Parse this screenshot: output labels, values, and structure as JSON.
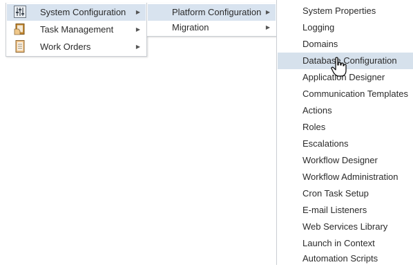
{
  "menu_level1": {
    "items": [
      {
        "label": "System Configuration",
        "icon": "settings-sliders-icon",
        "selected": true
      },
      {
        "label": "Task Management",
        "icon": "clipboard-hand-icon",
        "selected": false
      },
      {
        "label": "Work Orders",
        "icon": "document-icon",
        "selected": false
      }
    ]
  },
  "menu_level2": {
    "items": [
      {
        "label": "Platform Configuration",
        "selected": true
      },
      {
        "label": "Migration",
        "selected": false
      }
    ]
  },
  "menu_level3": {
    "items": [
      {
        "label": "System Properties"
      },
      {
        "label": "Logging"
      },
      {
        "label": "Domains"
      },
      {
        "label": "Database Configuration"
      },
      {
        "label": "Application Designer"
      },
      {
        "label": "Communication Templates"
      },
      {
        "label": "Actions"
      },
      {
        "label": "Roles"
      },
      {
        "label": "Escalations"
      },
      {
        "label": "Workflow Designer"
      },
      {
        "label": "Workflow Administration"
      },
      {
        "label": "Cron Task Setup"
      },
      {
        "label": "E-mail Listeners"
      },
      {
        "label": "Web Services Library"
      },
      {
        "label": "Launch in Context"
      },
      {
        "label": "Automation Scripts"
      }
    ],
    "hovered": "Database Configuration"
  },
  "colors": {
    "selected_bg": "#d8e3ef",
    "border": "#c9cdd2",
    "text": "#2b2b2b"
  }
}
